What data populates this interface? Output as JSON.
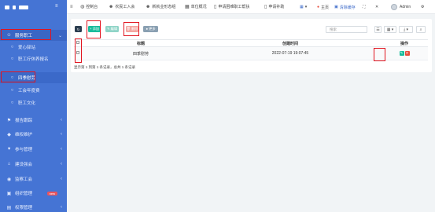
{
  "sidebar": {
    "groups": [
      {
        "label": "服务职工",
        "icon": "users-icon"
      },
      {
        "label": "报告跟踪",
        "icon": "flag-icon"
      },
      {
        "label": "维权维护",
        "icon": "shield-icon"
      },
      {
        "label": "参与管理",
        "icon": "heart-icon"
      },
      {
        "label": "建设强会",
        "icon": "home-icon"
      },
      {
        "label": "监察工会",
        "icon": "eye-icon"
      },
      {
        "label": "组织管理",
        "icon": "org-icon",
        "badge": "new"
      },
      {
        "label": "权限管理",
        "icon": "lock-icon"
      }
    ],
    "sub_items": [
      {
        "label": "爱心驿站",
        "icon": "circle-icon"
      },
      {
        "label": "职工疗休养报名",
        "icon": "circle-icon"
      },
      {
        "label": "四季慰劳",
        "icon": "circle-icon"
      },
      {
        "label": "工会年度费",
        "icon": "circle-icon"
      },
      {
        "label": "职工文化",
        "icon": "circle-icon"
      }
    ]
  },
  "topbar": {
    "items": [
      {
        "label": "控制台",
        "icon": "dashboard-icon"
      },
      {
        "label": "农民工入会",
        "icon": "user-plus-icon"
      },
      {
        "label": "新就业形态组",
        "icon": "team-icon"
      },
      {
        "label": "单位概况",
        "icon": "building-icon"
      },
      {
        "label": "申请困难职工帮扶",
        "icon": "file-icon"
      },
      {
        "label": "申请补助",
        "icon": "file-icon"
      }
    ],
    "home_label": "主页",
    "clear_label": "清除缓存",
    "user_name": "Admin"
  },
  "toolbar": {
    "refresh_icon": "refresh-icon",
    "add_label": "+ 添加",
    "edit_label": "✎ 编辑",
    "delete_label": "🗑 删除",
    "more_label": "● 更多",
    "search_placeholder": "搜索"
  },
  "table": {
    "headers": [
      "标题",
      "创建时间",
      "操作"
    ],
    "rows": [
      {
        "title": "四季慰劳",
        "created": "2022-07-19 19:07:45"
      }
    ]
  },
  "footer": {
    "summary": "显示第 1 到第 1 条记录，总共 1 条记录"
  },
  "colors": {
    "sidebar": "#4574d4",
    "add": "#18bc9c",
    "delete": "#e74c3c",
    "highlight": "#e1141f"
  }
}
